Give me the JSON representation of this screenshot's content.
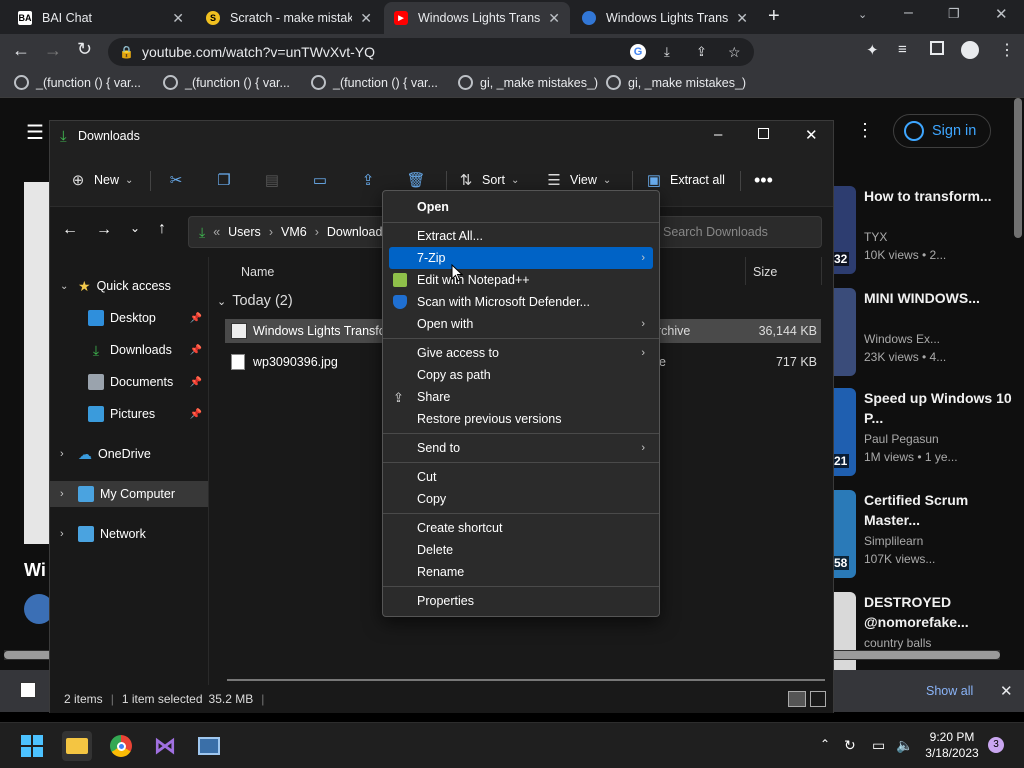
{
  "browser": {
    "tabs": [
      {
        "title": "BAI Chat",
        "favicon": "bai"
      },
      {
        "title": "Scratch - make mistake",
        "favicon": "scratch"
      },
      {
        "title": "Windows Lights Transfo",
        "favicon": "youtube"
      },
      {
        "title": "Windows Lights Transfo",
        "favicon": "edge"
      }
    ],
    "url": "youtube.com/watch?v=unTWvXvt-YQ",
    "bookmarks": [
      "_(function () {     var...",
      "_(function () {     var...",
      "_(function () {     var...",
      "gi, _make mistakes_)",
      "gi, _make mistakes_)"
    ]
  },
  "youtube": {
    "signin_label": "Sign in",
    "title_fragment": "Wi",
    "recommendations": [
      {
        "title": "How to transform...",
        "channel": "TYX",
        "meta": "10K views • 2...",
        "duration": "32"
      },
      {
        "title": "MINI WINDOWS...",
        "channel": "Windows Ex...",
        "meta": "23K views • 4...",
        "duration": ""
      },
      {
        "title": "Speed up Windows 10 P...",
        "channel": "Paul Pegasun",
        "meta": "1M views • 1 ye...",
        "duration": "21"
      },
      {
        "title": "Certified Scrum Master...",
        "channel": "Simplilearn",
        "meta": "107K views...",
        "duration": "58"
      },
      {
        "title": "DESTROYED @nomorefake...",
        "channel": "country balls",
        "meta": "",
        "duration": ""
      }
    ],
    "download_bar": {
      "show_all": "Show all"
    }
  },
  "explorer": {
    "title": "Downloads",
    "commands": {
      "new": "New",
      "sort": "Sort",
      "view": "View",
      "extract_all": "Extract all"
    },
    "breadcrumb": {
      "prefix": "«",
      "parts": [
        "Users",
        "VM6",
        "Downloads"
      ]
    },
    "search_placeholder": "Search Downloads",
    "columns": {
      "name": "Name",
      "size": "Size"
    },
    "group_header": "Today (2)",
    "files": [
      {
        "name": "Windows Lights Transform",
        "type": "archive",
        "size": "36,144 KB",
        "selected": true
      },
      {
        "name": "wp3090396.jpg",
        "type": "file",
        "size": "717 KB",
        "selected": false
      }
    ],
    "sidebar": {
      "quick_access": "Quick access",
      "pinned": [
        "Desktop",
        "Downloads",
        "Documents",
        "Pictures"
      ],
      "onedrive": "OneDrive",
      "my_computer": "My Computer",
      "network": "Network"
    },
    "status": {
      "items": "2 items",
      "selected": "1 item selected",
      "size": "35.2 MB"
    }
  },
  "context_menu": {
    "items": [
      {
        "label": "Open",
        "bold": true
      },
      {
        "label": "Extract All..."
      },
      {
        "label": "7-Zip",
        "highlighted": true,
        "submenu": true
      },
      {
        "label": "Edit with Notepad++",
        "icon": "notepad-icon"
      },
      {
        "label": "Scan with Microsoft Defender...",
        "icon": "defender-icon"
      },
      {
        "label": "Open with",
        "submenu": true
      },
      {
        "label": "Give access to",
        "submenu": true
      },
      {
        "label": "Copy as path"
      },
      {
        "label": "Share",
        "icon": "share-icon"
      },
      {
        "label": "Restore previous versions"
      },
      {
        "label": "Send to",
        "submenu": true
      },
      {
        "label": "Cut"
      },
      {
        "label": "Copy"
      },
      {
        "label": "Create shortcut"
      },
      {
        "label": "Delete"
      },
      {
        "label": "Rename"
      },
      {
        "label": "Properties"
      }
    ]
  },
  "taskbar": {
    "time": "9:20 PM",
    "date": "3/18/2023",
    "notification_count": "3"
  },
  "colors": {
    "accent": "#0063c6",
    "youtube_blue": "#3ea6ff",
    "chrome_dark": "#202124"
  }
}
